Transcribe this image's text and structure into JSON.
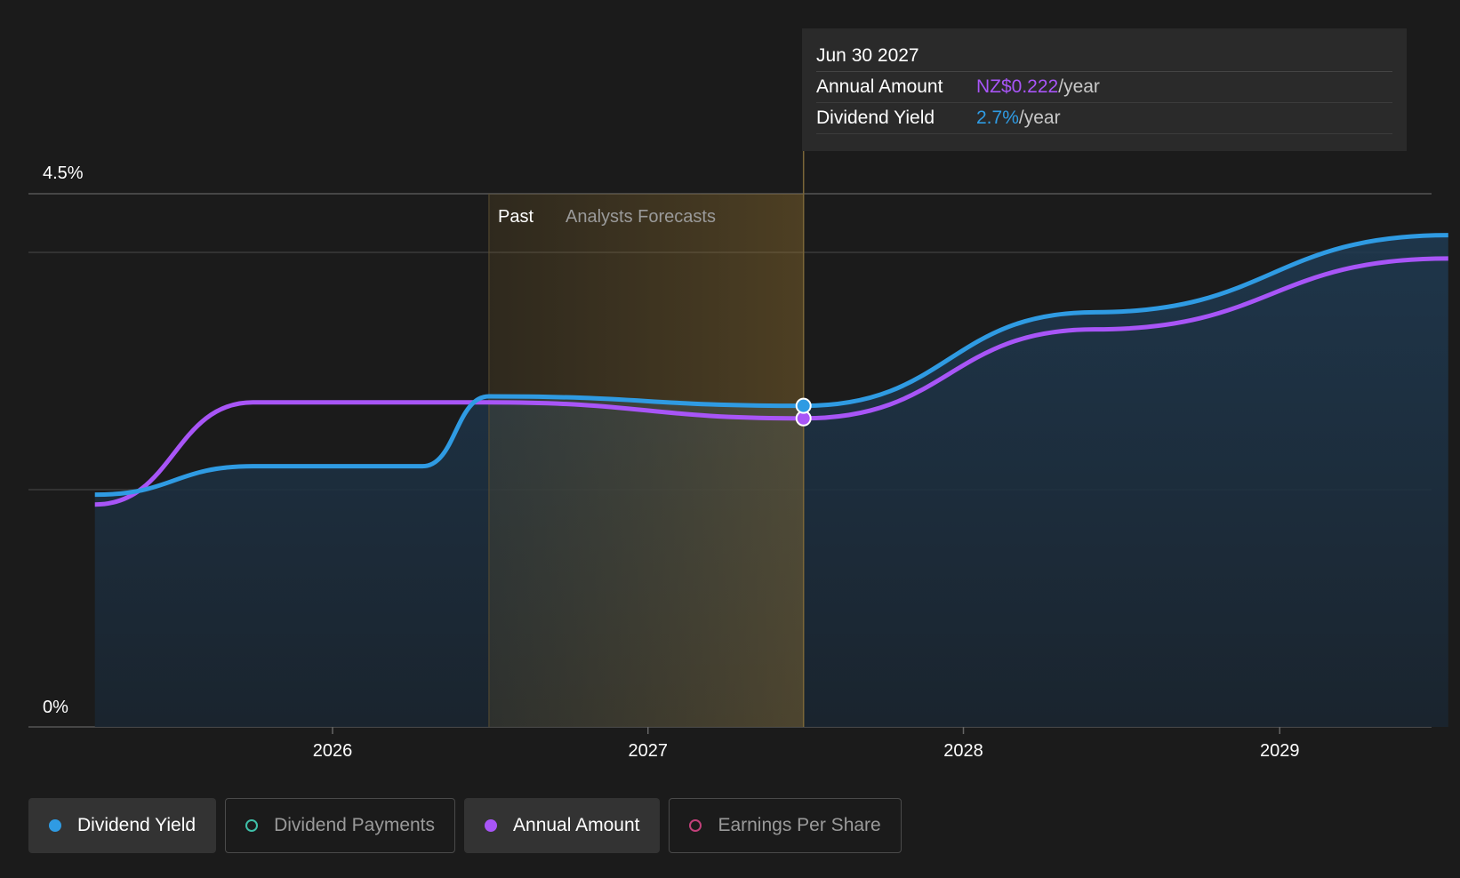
{
  "chart_data": {
    "type": "line",
    "y_axis": {
      "min_label": "0%",
      "max_label": "4.5%",
      "ylim": [
        0,
        4.5
      ]
    },
    "x_ticks": [
      "2026",
      "2027",
      "2028",
      "2029"
    ],
    "regions": {
      "past_label": "Past",
      "forecast_label": "Analysts Forecasts"
    },
    "series": [
      {
        "name": "Dividend Yield",
        "color": "#2f9be3",
        "unit": "%",
        "points": [
          [
            "2025-04-01",
            1.96
          ],
          [
            "2025-10-01",
            2.2
          ],
          [
            "2026-04-15",
            2.2
          ],
          [
            "2026-07-01",
            2.79
          ],
          [
            "2027-06-30",
            2.71
          ],
          [
            "2028-06-01",
            3.5
          ],
          [
            "2029-07-15",
            4.15
          ]
        ]
      },
      {
        "name": "Annual Amount",
        "color": "#a855f7",
        "unit": "NZ$",
        "points": [
          [
            "2025-04-01",
            0.16
          ],
          [
            "2025-10-01",
            0.2335
          ],
          [
            "2026-07-01",
            0.2335
          ],
          [
            "2027-06-30",
            0.222
          ],
          [
            "2028-06-01",
            0.286
          ],
          [
            "2029-07-15",
            0.337
          ]
        ]
      }
    ],
    "grid": true
  },
  "tooltip": {
    "date": "Jun 30 2027",
    "rows": [
      {
        "key": "Annual Amount",
        "value": "NZ$0.222",
        "unit": "/year",
        "color": "#a855f7"
      },
      {
        "key": "Dividend Yield",
        "value": "2.7%",
        "unit": "/year",
        "color": "#2f9be3"
      }
    ]
  },
  "legend": [
    {
      "label": "Dividend Yield",
      "color": "#2f9be3",
      "active": true
    },
    {
      "label": "Dividend Payments",
      "color": "#3fbfa8",
      "active": false
    },
    {
      "label": "Annual Amount",
      "color": "#a855f7",
      "active": true
    },
    {
      "label": "Earnings Per Share",
      "color": "#c2407a",
      "active": false
    }
  ]
}
